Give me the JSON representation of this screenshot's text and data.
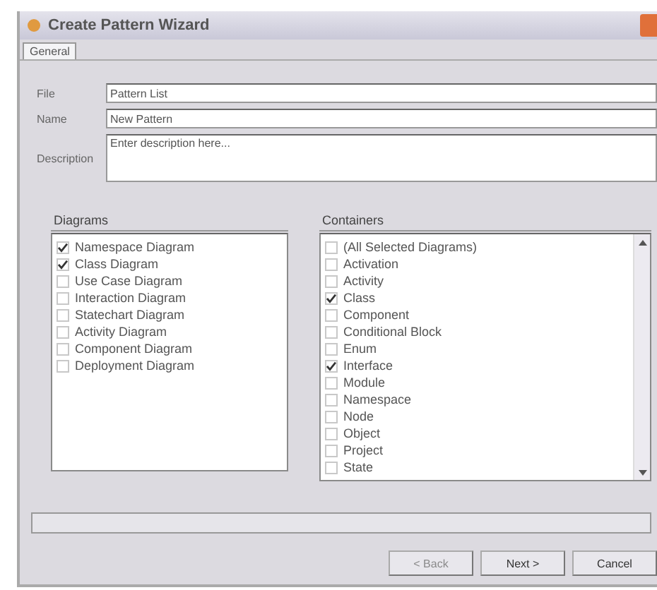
{
  "window": {
    "title": "Create Pattern Wizard"
  },
  "tabs": [
    {
      "label": "General",
      "selected": true
    }
  ],
  "fields": [
    {
      "label": "File",
      "value": "Pattern List"
    },
    {
      "label": "Name",
      "value": "New Pattern"
    },
    {
      "label": "Description",
      "placeholder": "Enter description here..."
    }
  ],
  "diagrams": {
    "title": "Diagrams",
    "items": [
      {
        "label": "Namespace Diagram",
        "checked": true
      },
      {
        "label": "Class Diagram",
        "checked": true
      },
      {
        "label": "Use Case Diagram",
        "checked": false
      },
      {
        "label": "Interaction Diagram",
        "checked": false
      },
      {
        "label": "Statechart Diagram",
        "checked": false
      },
      {
        "label": "Activity Diagram",
        "checked": false
      },
      {
        "label": "Component Diagram",
        "checked": false
      },
      {
        "label": "Deployment Diagram",
        "checked": false
      }
    ]
  },
  "containers": {
    "title": "Containers",
    "items": [
      {
        "label": "(All Selected Diagrams)",
        "checked": false
      },
      {
        "label": "Activation",
        "checked": false
      },
      {
        "label": "Activity",
        "checked": false
      },
      {
        "label": "Class",
        "checked": true
      },
      {
        "label": "Component",
        "checked": false
      },
      {
        "label": "Conditional Block",
        "checked": false
      },
      {
        "label": "Enum",
        "checked": false
      },
      {
        "label": "Interface",
        "checked": true
      },
      {
        "label": "Module",
        "checked": false
      },
      {
        "label": "Namespace",
        "checked": false
      },
      {
        "label": "Node",
        "checked": false
      },
      {
        "label": "Object",
        "checked": false
      },
      {
        "label": "Project",
        "checked": false
      },
      {
        "label": "State",
        "checked": false
      }
    ]
  },
  "progress": {
    "level": 0
  },
  "buttons": [
    {
      "label": "< Back",
      "disabled": true
    },
    {
      "label": "Next >",
      "disabled": false
    },
    {
      "label": "Cancel",
      "disabled": false
    }
  ]
}
